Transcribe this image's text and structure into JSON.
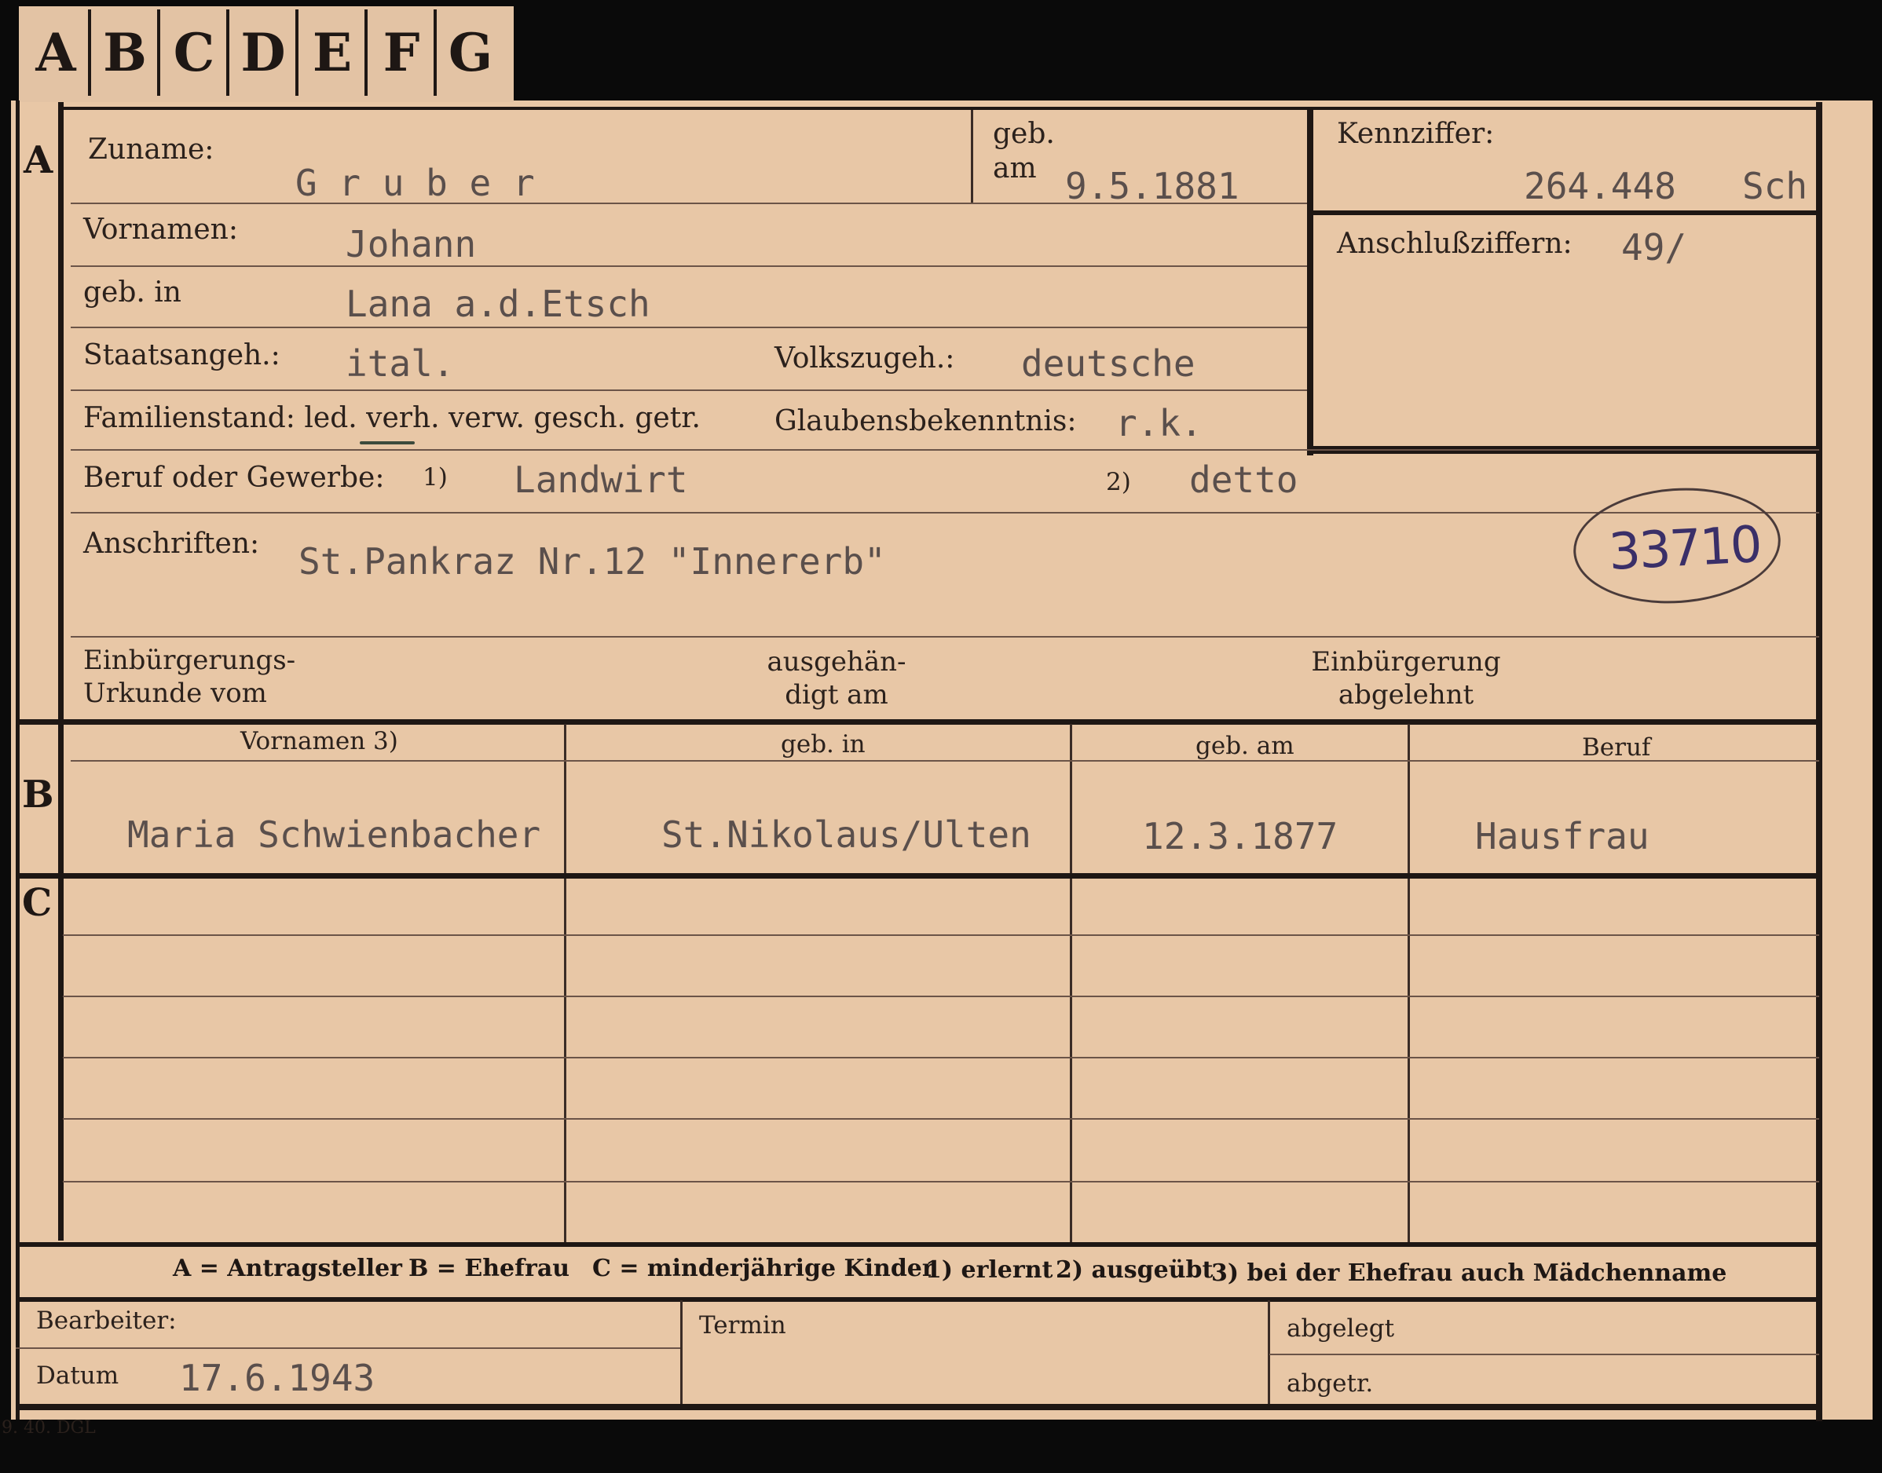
{
  "tabs": [
    "A",
    "B",
    "C",
    "D",
    "E",
    "F",
    "G"
  ],
  "sections": {
    "a": "A",
    "b": "B",
    "c": "C"
  },
  "applicant": {
    "surname_label": "Zuname:",
    "surname": "G r u b e r",
    "birthdate_label_line1": "geb.",
    "birthdate_label_line2": "am",
    "birthdate": "9.5.1881",
    "id_label": "Kennziffer:",
    "id_number": "264.448",
    "id_suffix": "Sch",
    "firstnames_label": "Vornamen:",
    "firstnames": "Johann",
    "connection_label": "Anschlußziffern:",
    "connection_value": "49/",
    "birthplace_label": "geb. in",
    "birthplace": "Lana a.d.Etsch",
    "citizenship_label": "Staatsangeh.:",
    "citizenship": "ital.",
    "ethnicity_label": "Volkszugeh.:",
    "ethnicity": "deutsche",
    "marital_label": "Familienstand: led. verh. verw. gesch. getr.",
    "religion_label": "Glaubensbekenntnis:",
    "religion": "r.k.",
    "occupation_label": "Beruf oder Gewerbe:",
    "occ1_marker": "1)",
    "occupation_learned": "Landwirt",
    "occ2_marker": "2)",
    "occupation_practiced": "detto",
    "address_label": "Anschriften:",
    "address": "St.Pankraz Nr.12 \"Innererb\"",
    "stamp_number": "33710",
    "naturalization_label": "Einbürgerungs-\nUrkunde vom",
    "handed_label": "ausgehän-\ndigt am",
    "rejected_label": "Einbürgerung\nabgelehnt"
  },
  "spouse_table": {
    "headers": [
      "Vornamen 3)",
      "geb. in",
      "geb. am",
      "Beruf"
    ],
    "row": [
      "Maria Schwienbacher",
      "St.Nikolaus/Ulten",
      "12.3.1877",
      "Hausfrau"
    ]
  },
  "legend": {
    "a": "A = Antragsteller",
    "b": "B = Ehefrau",
    "c": "C = minderjährige Kinder",
    "n1": "1) erlernt",
    "n2": "2) ausgeübt",
    "n3": "3) bei der Ehefrau auch Mädchenname"
  },
  "footer": {
    "clerk_label": "Bearbeiter:",
    "date_label": "Datum",
    "date": "17.6.1943",
    "deadline_label": "Termin",
    "filed_label": "abgelegt",
    "sent_label": "abgetr.",
    "print_code": "9. 40. DGL"
  }
}
